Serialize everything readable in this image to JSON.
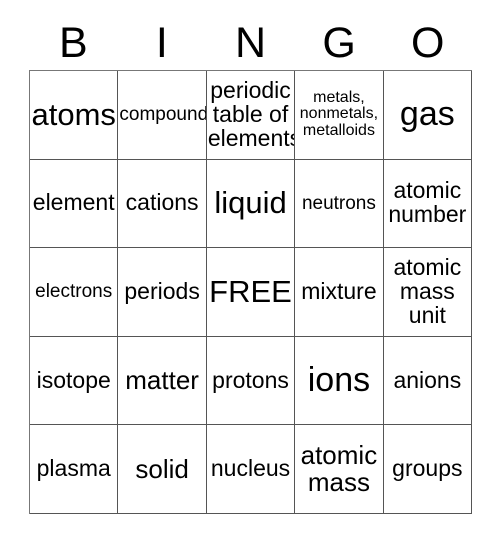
{
  "card": {
    "header_letters": [
      "B",
      "I",
      "N",
      "G",
      "O"
    ],
    "free_space_label": "FREE",
    "colors": {
      "text": "#000000",
      "grid_line": "#555555",
      "background": "#ffffff"
    },
    "rows": [
      [
        {
          "text": "atoms",
          "size": "lg"
        },
        {
          "text": "compound",
          "size": "sm"
        },
        {
          "text": "periodic\ntable of\nelements",
          "size": "md"
        },
        {
          "text": "metals,\nnonmetals,\nmetalloids",
          "size": "xs"
        },
        {
          "text": "gas",
          "size": "xl"
        }
      ],
      [
        {
          "text": "element",
          "size": "md"
        },
        {
          "text": "cations",
          "size": "md"
        },
        {
          "text": "liquid",
          "size": "lg"
        },
        {
          "text": "neutrons",
          "size": "sm"
        },
        {
          "text": "atomic\nnumber",
          "size": "md"
        }
      ],
      [
        {
          "text": "electrons",
          "size": "sm"
        },
        {
          "text": "periods",
          "size": "md"
        },
        {
          "text": "FREE",
          "size": "lg"
        },
        {
          "text": "mixture",
          "size": "md"
        },
        {
          "text": "atomic\nmass\nunit",
          "size": "md"
        }
      ],
      [
        {
          "text": "isotope",
          "size": "md"
        },
        {
          "text": "matter",
          "size": "mdl"
        },
        {
          "text": "protons",
          "size": "md"
        },
        {
          "text": "ions",
          "size": "xl"
        },
        {
          "text": "anions",
          "size": "md"
        }
      ],
      [
        {
          "text": "plasma",
          "size": "md"
        },
        {
          "text": "solid",
          "size": "mdl"
        },
        {
          "text": "nucleus",
          "size": "md"
        },
        {
          "text": "atomic\nmass",
          "size": "mdl"
        },
        {
          "text": "groups",
          "size": "md"
        }
      ]
    ]
  }
}
